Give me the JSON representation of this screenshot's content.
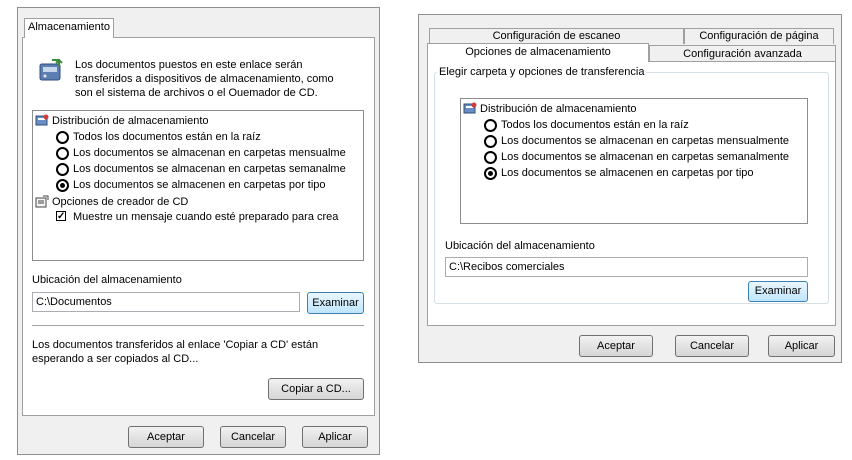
{
  "left_dialog": {
    "tab": "Almacenamiento",
    "description": [
      "Los documentos puestos en este enlace serán",
      "transferidos a dispositivos de almacenamiento, como",
      "son el sistema de archivos o el Ouemador de CD."
    ],
    "options": {
      "section1": "Distribución de almacenamiento",
      "radios": [
        {
          "label": "Todos los documentos están en la raíz",
          "selected": false
        },
        {
          "label": "Los documentos se almacenan en carpetas mensualme",
          "selected": false
        },
        {
          "label": "Los documentos se almacenan en carpetas semanalme",
          "selected": false
        },
        {
          "label": "Los documentos se almacenen en carpetas por tipo",
          "selected": true
        }
      ],
      "section2": "Opciones de creador de CD",
      "checkbox": {
        "label": "Muestre un mensaje cuando esté preparado para crea",
        "checked": true
      }
    },
    "location_label": "Ubicación del almacenamiento",
    "location_value": "C:\\Documentos",
    "browse": "Examinar",
    "cd_text": [
      "Los documentos transferidos al enlace 'Copiar a CD' están",
      "esperando a ser copiados al CD..."
    ],
    "copy_cd": "Copiar a CD...",
    "ok": "Aceptar",
    "cancel": "Cancelar",
    "apply": "Aplicar"
  },
  "right_dialog": {
    "tabs_back": [
      "Configuración de escaneo",
      "Configuración de página"
    ],
    "tabs_front": [
      "Opciones de almacenamiento",
      "Configuración avanzada"
    ],
    "group_title": "Elegir carpeta y opciones de transferencia",
    "section": "Distribución de almacenamiento",
    "radios": [
      {
        "label": "Todos los documentos están en la raíz",
        "selected": false
      },
      {
        "label": "Los documentos se almacenan en carpetas mensualmente",
        "selected": false
      },
      {
        "label": "Los documentos se almacenan en carpetas semanalmente",
        "selected": false
      },
      {
        "label": "Los documentos se almacenen en carpetas por tipo",
        "selected": true
      }
    ],
    "location_label": "Ubicación del almacenamiento",
    "location_value": "C:\\Recibos comerciales",
    "browse": "Examinar",
    "ok": "Aceptar",
    "cancel": "Cancelar",
    "apply": "Aplicar"
  }
}
